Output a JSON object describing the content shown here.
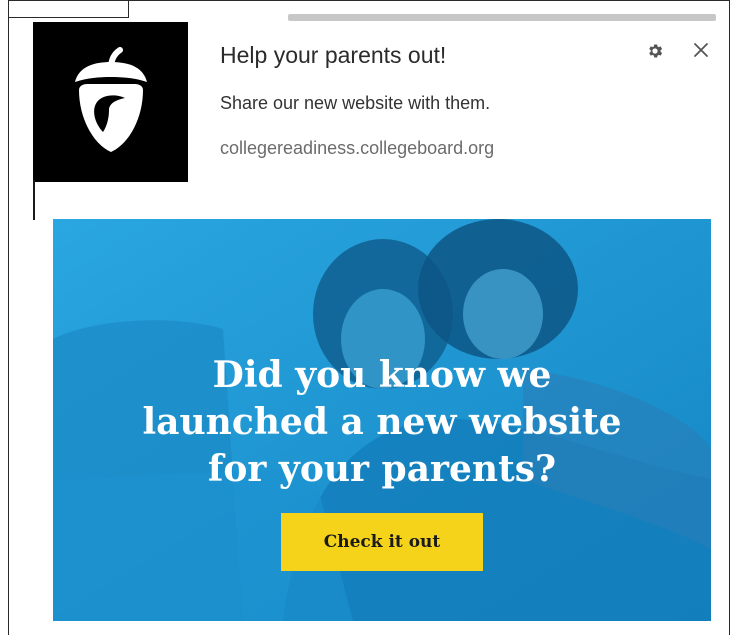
{
  "notification": {
    "title": "Help your parents out!",
    "message": "Share our new website with them.",
    "origin": "collegereadiness.collegeboard.org",
    "icons": {
      "logo": "acorn-icon",
      "settings": "gear-icon",
      "close": "close-icon"
    }
  },
  "banner": {
    "headline_lines": [
      "Did you know we",
      "launched a new website",
      "for your parents?"
    ],
    "cta_label": "Check it out"
  },
  "colors": {
    "banner_blue": "#1f9ad6",
    "cta_yellow": "#f5d31a",
    "logo_bg": "#000000"
  }
}
